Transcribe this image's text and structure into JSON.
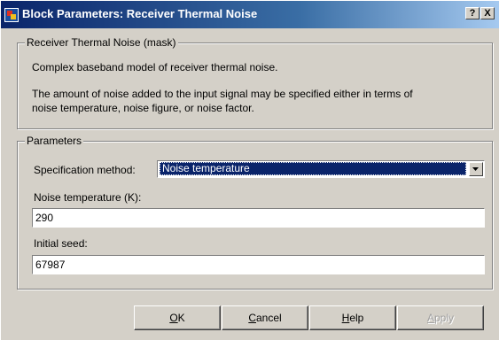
{
  "window": {
    "title": "Block Parameters: Receiver Thermal Noise",
    "help_glyph": "?",
    "close_glyph": "X",
    "icon": "simulink-block-icon"
  },
  "description": {
    "legend": "Receiver Thermal Noise (mask)",
    "line1": "Complex baseband model of receiver thermal noise.",
    "line2": "The amount of noise added to the input signal may be specified either in terms of",
    "line3": "noise temperature, noise figure, or noise factor."
  },
  "parameters": {
    "legend": "Parameters",
    "spec_method_label": "Specification method:",
    "spec_method_value": "Noise temperature",
    "noise_temp_label": "Noise temperature (K):",
    "noise_temp_value": "290",
    "seed_label": "Initial seed:",
    "seed_value": "67987"
  },
  "buttons": {
    "ok": {
      "mnemonic": "O",
      "rest": "K"
    },
    "cancel": {
      "mnemonic": "C",
      "rest": "ancel"
    },
    "help": {
      "mnemonic": "H",
      "rest": "elp"
    },
    "apply": {
      "mnemonic": "A",
      "rest": "pply"
    }
  },
  "colors": {
    "titlebar_start": "#0a246a",
    "titlebar_end": "#a6caf0",
    "face": "#d4d0c8"
  }
}
